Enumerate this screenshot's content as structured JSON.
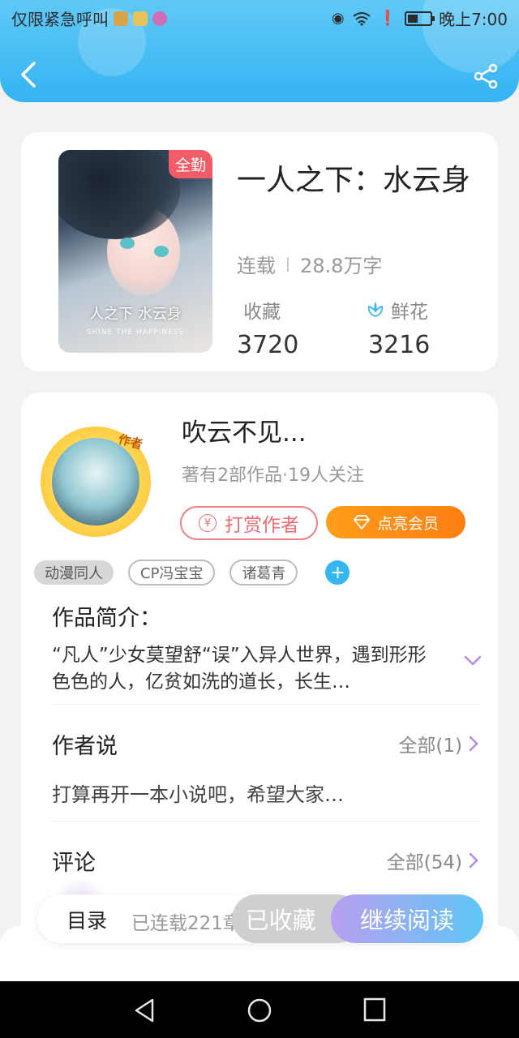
{
  "status_bar": {
    "left_text": "仅限紧急呼叫",
    "time": "晚上7:00",
    "icons": [
      "eye-icon",
      "wifi-icon",
      "alert-icon",
      "battery-icon"
    ]
  },
  "header": {
    "back_icon": "chevron-left-icon",
    "share_icon": "share-icon"
  },
  "book": {
    "cover_badge": "全勤",
    "cover_title": "人之下 水云身",
    "cover_subtitle": "SHINE THE HAPPINESS",
    "title": "一人之下：水云身",
    "status": "连载",
    "word_count": "28.8万字",
    "favorites_label": "收藏",
    "favorites_count": "3720",
    "flowers_label": "鲜花",
    "flowers_count": "3216"
  },
  "author": {
    "avatar_tag": "作者",
    "name": "吹云不见...",
    "summary": "著有2部作品·19人关注",
    "reward_label": "打赏作者",
    "vip_label": "点亮会员"
  },
  "tags": [
    "动漫同人",
    "CP冯宝宝",
    "诸葛青"
  ],
  "intro": {
    "title": "作品简介：",
    "text": "“凡人”少女莫望舒“误”入异人世界，遇到形形色色的人，亿贫如洗的道长，长生…"
  },
  "author_says": {
    "title": "作者说",
    "all_label": "全部(1)",
    "text": "打算再开一本小说吧，希望大家…"
  },
  "comments": {
    "title": "评论",
    "all_label": "全部(54)"
  },
  "bottom": {
    "toc_label": "目录",
    "serialized_text": "已连载221章",
    "collected_label": "已收藏",
    "continue_label": "继续阅读"
  },
  "colors": {
    "header_blue": "#35b3f3",
    "badge_red": "#f25c67",
    "vip_orange": "#ff8a14",
    "tag_add_blue": "#36b7f2"
  }
}
